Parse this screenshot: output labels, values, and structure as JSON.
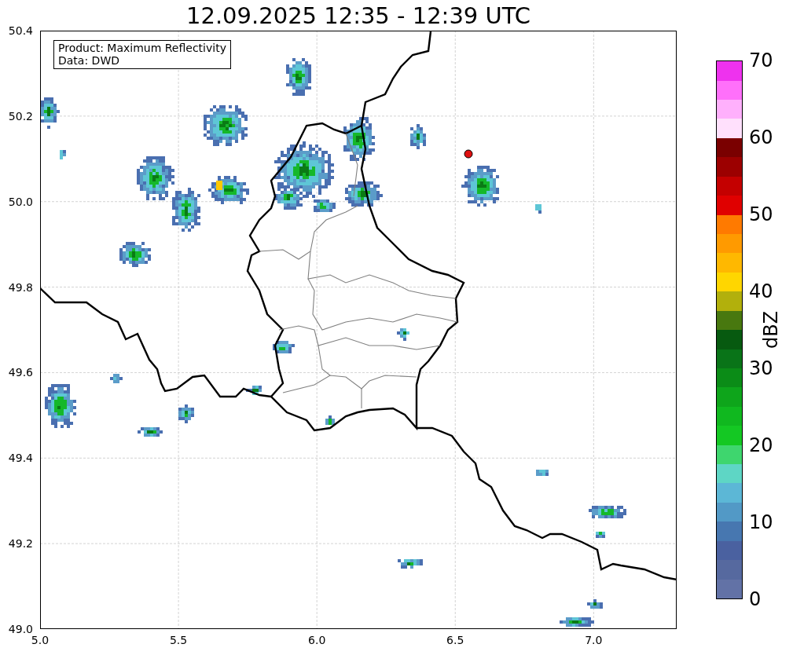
{
  "plot": {
    "title": "12.09.2025 12:35 - 12:39 UTC",
    "info_box": [
      "Product: Maximum Reflectivity",
      "Data: DWD"
    ],
    "y_ticks": [
      "50.4",
      "50.2",
      "50.0",
      "49.8",
      "49.6",
      "49.4",
      "49.2",
      "49.0"
    ],
    "x_ticks": [
      "5.0",
      "5.5",
      "6.0",
      "6.5",
      "7.0"
    ]
  },
  "colorbar": {
    "label": "dBZ",
    "ticks": [
      "70",
      "60",
      "50",
      "40",
      "30",
      "20",
      "10",
      "0"
    ]
  }
}
